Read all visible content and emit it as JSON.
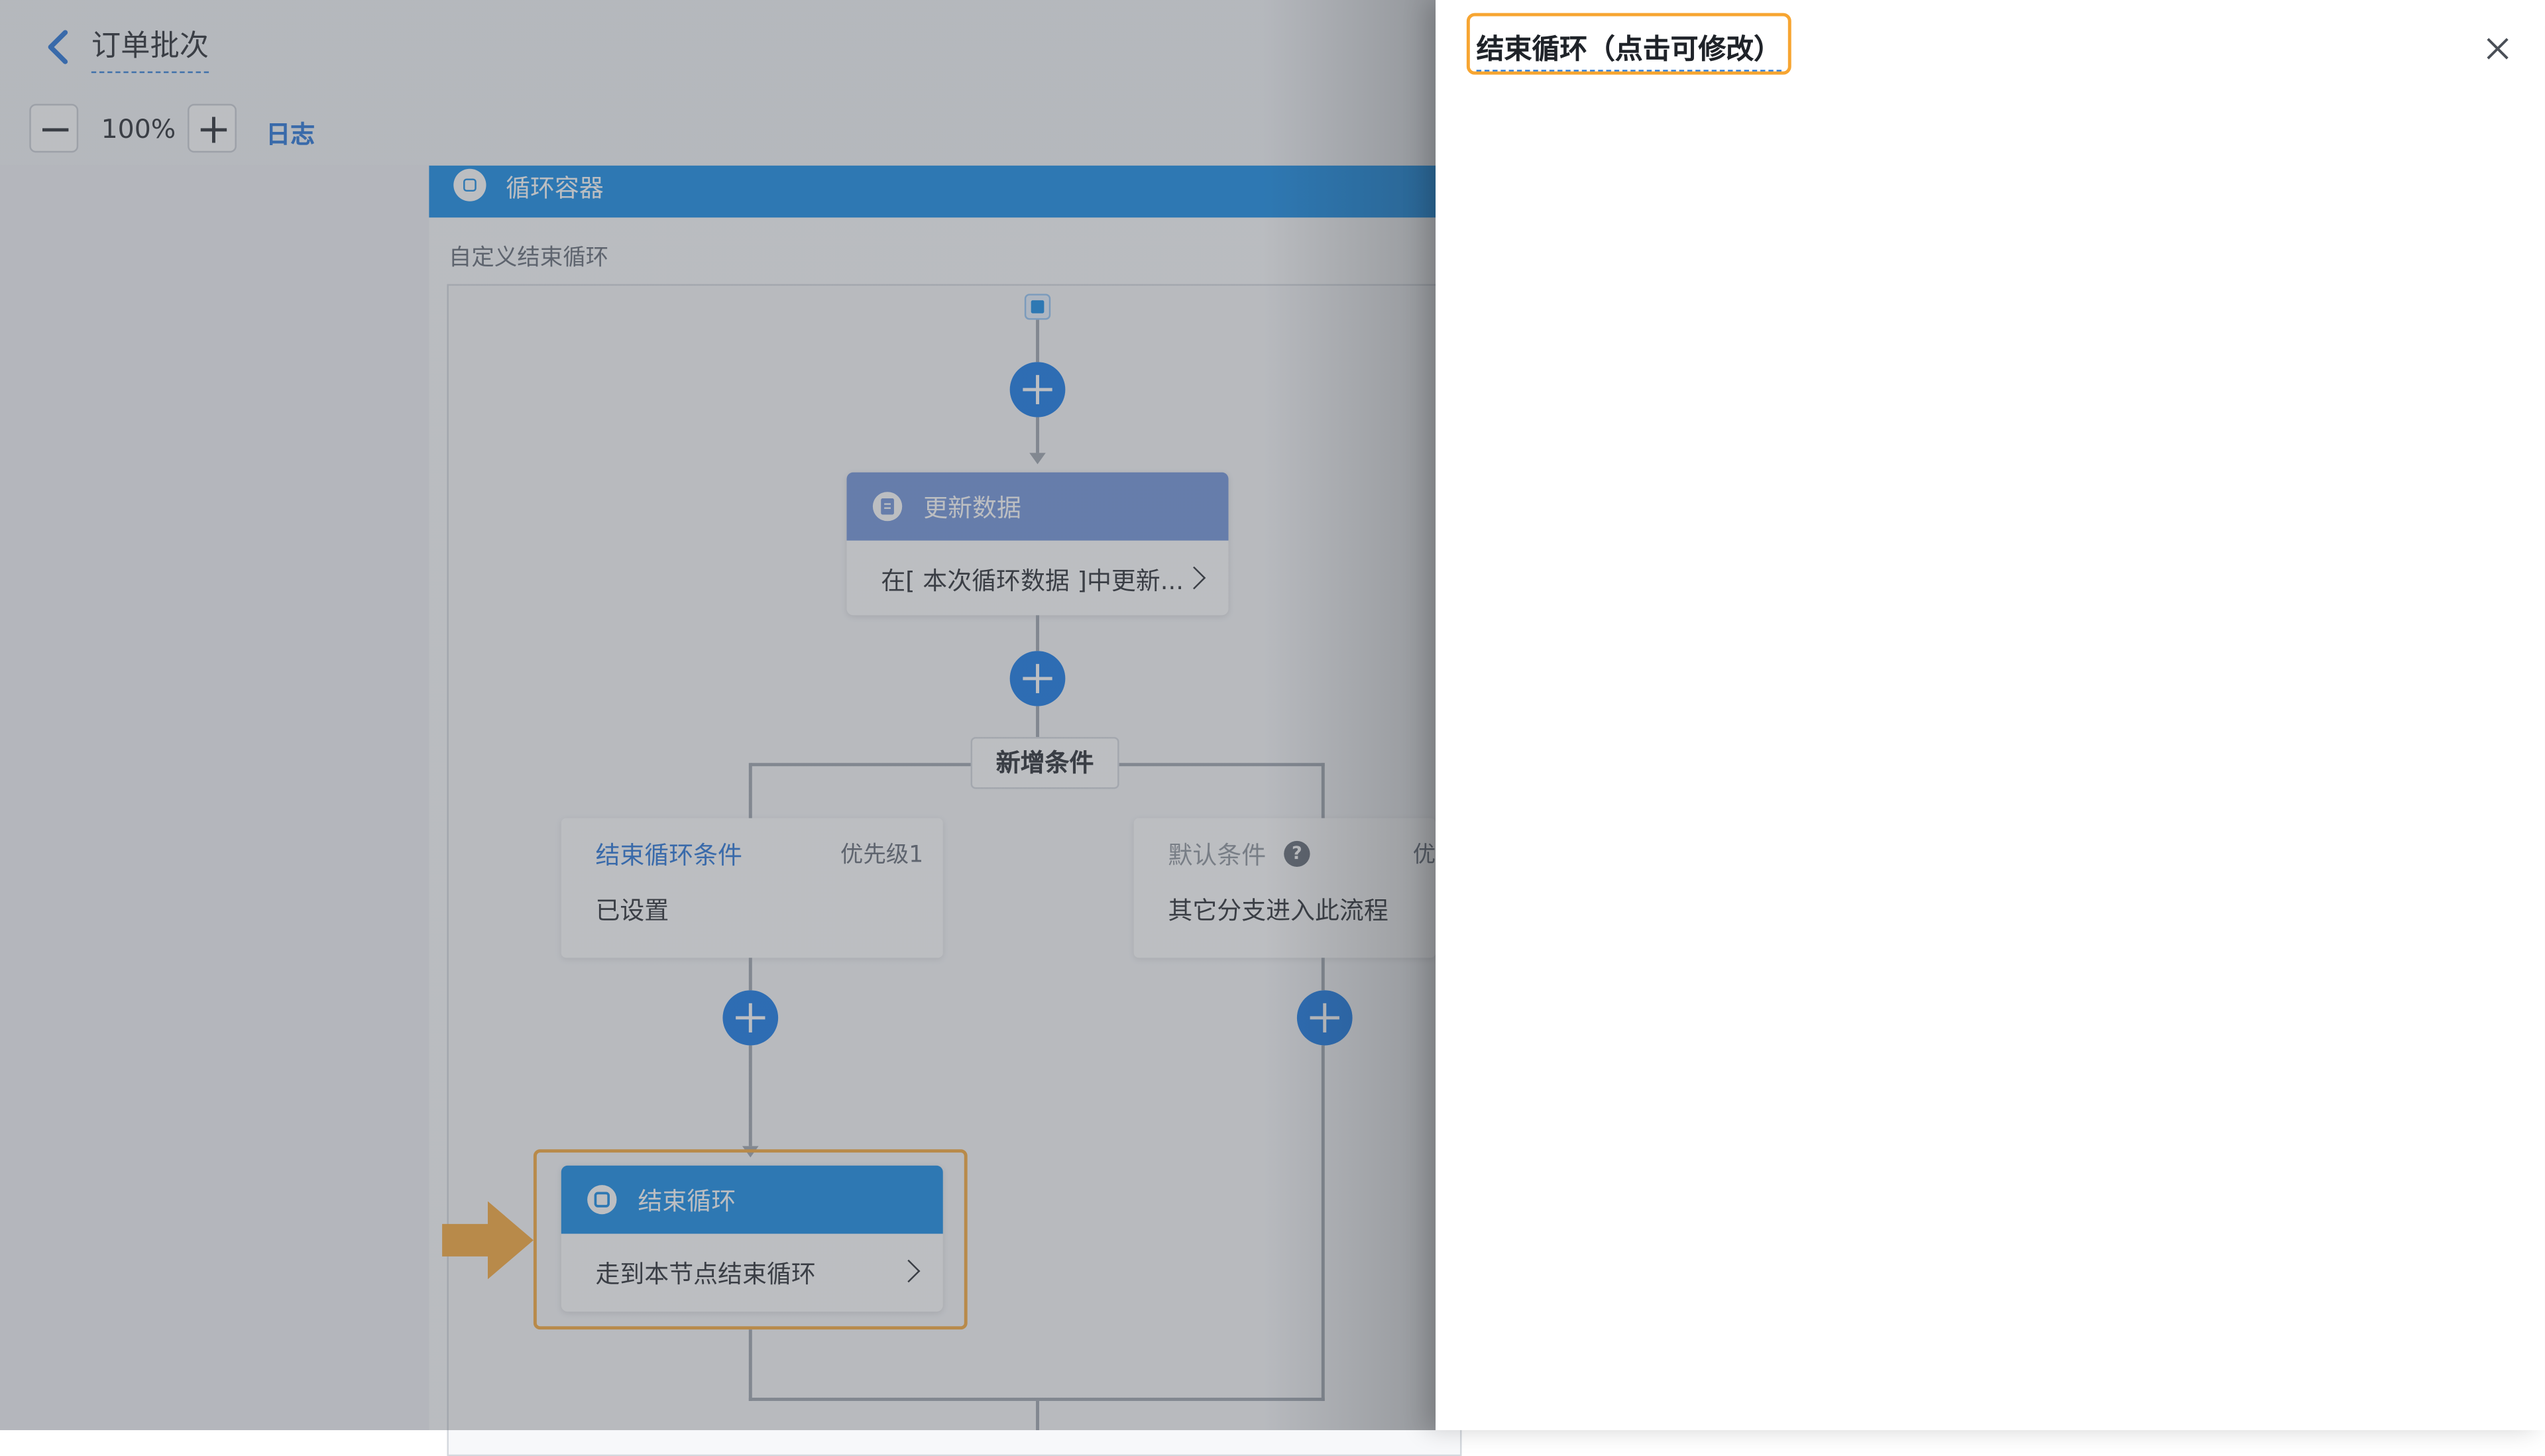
{
  "header": {
    "title": "订单批次"
  },
  "toolbar": {
    "zoom_value": "100%",
    "log_label": "日志"
  },
  "loop_container": {
    "title": "循环容器",
    "end_mode_label": "自定义结束循环"
  },
  "update_node": {
    "title": "更新数据",
    "summary": "在[ 本次循环数据 ]中更新..."
  },
  "branch": {
    "add_condition_label": "新增条件"
  },
  "conditions": [
    {
      "title": "结束循环条件",
      "priority": "优先级1",
      "desc": "已设置"
    },
    {
      "title": "默认条件",
      "priority": "优",
      "desc": "其它分支进入此流程"
    }
  ],
  "end_loop_node": {
    "title": "结束循环",
    "summary": "走到本节点结束循环"
  },
  "drawer": {
    "title": "结束循环（点击可修改）"
  },
  "colors": {
    "accent": "#0a73e6",
    "highlight": "#f7a531",
    "update_header": "#6a8fd8",
    "loop_header": "#0a87e6"
  }
}
